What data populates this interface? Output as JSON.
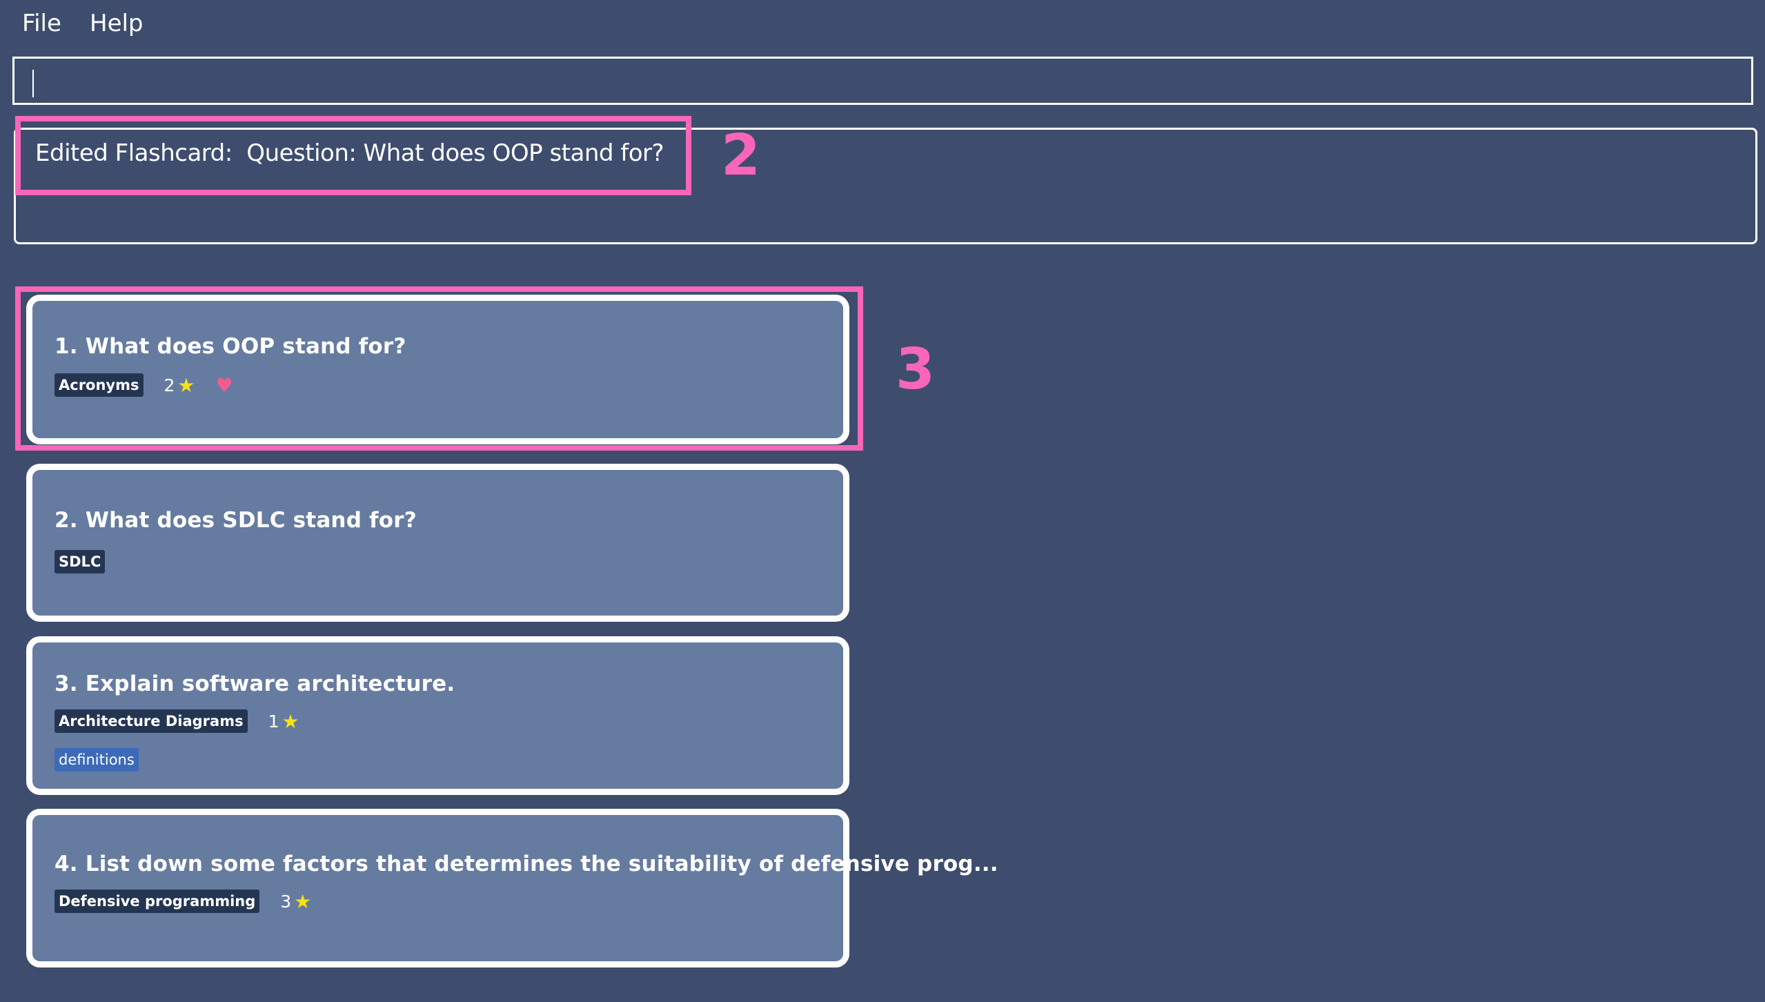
{
  "menu": {
    "file_label": "File",
    "help_label": "Help"
  },
  "command_box": {
    "value": ""
  },
  "result_display": {
    "text": "Edited Flashcard:  Question: What does OOP stand for?"
  },
  "annotations": {
    "label_2": "2",
    "label_3": "3"
  },
  "flashcards": [
    {
      "title": "1.  What does OOP stand for?",
      "tags": [
        "Acronyms"
      ],
      "rating": "2",
      "favourite": true
    },
    {
      "title": "2.  What does SDLC stand for?",
      "tags": [
        "SDLC"
      ],
      "rating": null,
      "favourite": false
    },
    {
      "title": "3.  Explain software architecture.",
      "tags": [
        "Architecture Diagrams",
        "definitions"
      ],
      "rating": "1",
      "favourite": false
    },
    {
      "title": "4.  List down some factors that determines the suitability of defensive prog...",
      "tags": [
        "Defensive programming"
      ],
      "rating": "3",
      "favourite": false
    }
  ],
  "icons": {
    "star": "star-icon",
    "heart": "heart-icon"
  },
  "colors": {
    "background": "#3e4d6e",
    "card": "#667ba0",
    "tag": "#243552",
    "tag_light": "#3d6ab8",
    "star": "#f5e313",
    "heart": "#f45a92",
    "annotation": "#f766b9"
  }
}
